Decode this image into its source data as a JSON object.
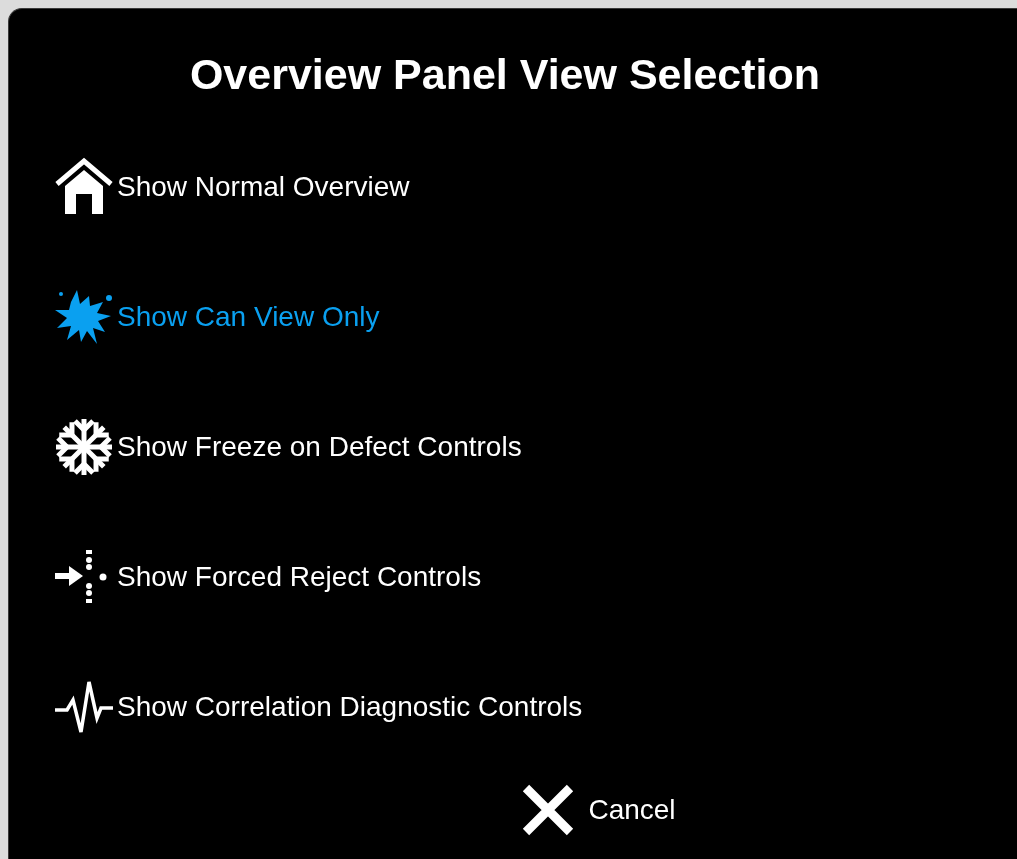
{
  "dialog": {
    "title": "Overview Panel View Selection"
  },
  "options": [
    {
      "kind": "home",
      "label": "Show Normal Overview",
      "selected": false
    },
    {
      "kind": "splat",
      "label": "Show Can View Only",
      "selected": true
    },
    {
      "kind": "snowflake",
      "label": "Show Freeze on Defect Controls",
      "selected": false
    },
    {
      "kind": "reject",
      "label": "Show Forced Reject Controls",
      "selected": false
    },
    {
      "kind": "pulse",
      "label": "Show Correlation Diagnostic Controls",
      "selected": false
    }
  ],
  "cancel_button": {
    "label": "Cancel"
  }
}
